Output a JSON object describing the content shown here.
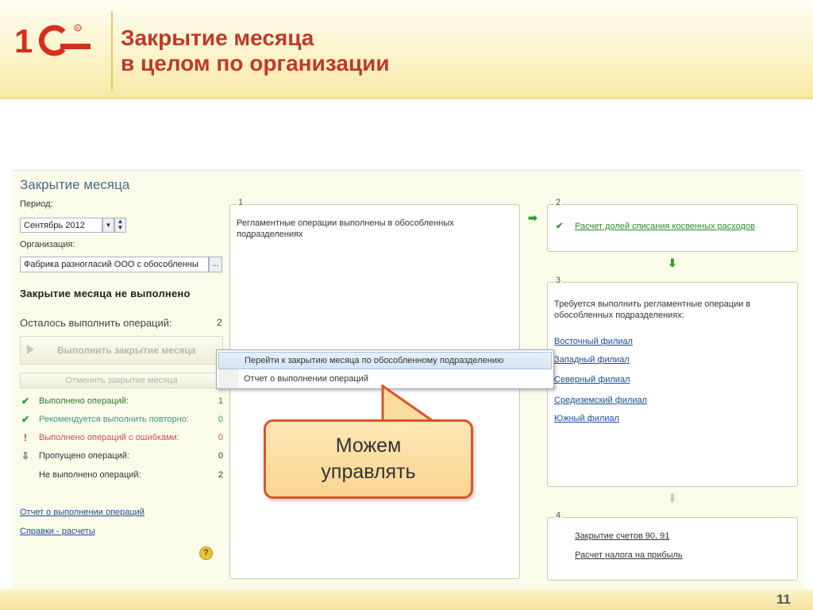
{
  "slide": {
    "logo_text": "1С",
    "title_line1": "Закрытие месяца",
    "title_line2": "в целом по организации",
    "page_number": "11",
    "brand_color": "#c0392b"
  },
  "form": {
    "title": "Закрытие месяца",
    "period_label": "Период:",
    "period_value": "Сентябрь 2012",
    "organization_label": "Организация:",
    "organization_value": "Фабрика разногласий ООО с обособленны",
    "status": "Закрытие месяца не выполнено",
    "remaining_label": "Осталось выполнить операций:",
    "remaining_count": "2",
    "run_button": "Выполнить закрытие месяца",
    "cancel_button": "Отменить закрытие месяца",
    "stats": [
      {
        "icon": "check-icon",
        "label": "Выполнено операций:",
        "count": "1",
        "color": "#2a9a2a"
      },
      {
        "icon": "check-icon",
        "label": "Рекомендуется выполнить повторно:",
        "count": "0",
        "color": "#2a9a2a"
      },
      {
        "icon": "exclamation-icon",
        "label": "Выполнено операций с ошибками:",
        "count": "0",
        "color": "#d03030"
      },
      {
        "icon": "arrow-down-icon",
        "label": "Пропущено операций:",
        "count": "0",
        "color": "#333333"
      },
      {
        "icon": "",
        "label": "Не выполнено операций:",
        "count": "2",
        "color": "#333333"
      }
    ],
    "link_report": "Отчет о выполнении операций",
    "link_help": "Справки - расчеты",
    "help_icon": "?"
  },
  "panels": {
    "p1": {
      "num": "1",
      "text": "Регламентные операции выполнены в обособленных подразделениях"
    },
    "p2": {
      "num": "2",
      "link": "Расчет долей списания косвенных расходов"
    },
    "p3": {
      "num": "3",
      "text": "Требуется выполнить регламентные операции в обособленных подразделениях:",
      "branches": [
        "Восточный филиал",
        "Западный филиал",
        "Северный филиал",
        "Средиземский филиал",
        "Южный филиал"
      ]
    },
    "p4": {
      "num": "4",
      "items": [
        "Закрытие счетов 90, 91",
        "Расчет налога на прибыль"
      ]
    }
  },
  "dropdown": {
    "items": [
      "Перейти к закрытию месяца по обособленному подразделению",
      "Отчет о выполнении операций"
    ]
  },
  "callout": {
    "line1": "Можем",
    "line2": "управлять"
  }
}
